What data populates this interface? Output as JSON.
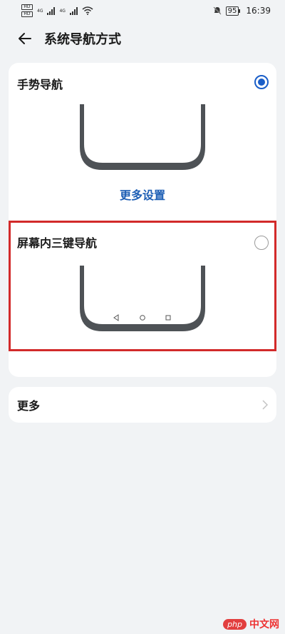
{
  "status_bar": {
    "sim1": "HD",
    "sim2": "HD",
    "net1": "4G",
    "net2": "4G",
    "battery": "95",
    "time": "16:39",
    "icons": [
      "signal-icon",
      "wifi-icon",
      "mute-bell-icon",
      "battery-icon"
    ]
  },
  "header": {
    "title": "系统导航方式",
    "back_icon": "back-arrow-icon"
  },
  "navigation_options": [
    {
      "label": "手势导航",
      "selected": true,
      "action_label": "更多设置"
    },
    {
      "label": "屏幕内三键导航",
      "selected": false,
      "nav_icons": [
        "triangle-back-icon",
        "circle-home-icon",
        "square-recents-icon"
      ]
    }
  ],
  "more_row": {
    "label": "更多",
    "chevron_icon": "chevron-right-icon"
  },
  "watermark": {
    "badge": "php",
    "text": "中文网"
  },
  "colors": {
    "accent": "#1a5ec8",
    "link": "#1e5fb5",
    "highlight": "#d22a2a",
    "background": "#f1f3f5",
    "card": "#ffffff"
  }
}
